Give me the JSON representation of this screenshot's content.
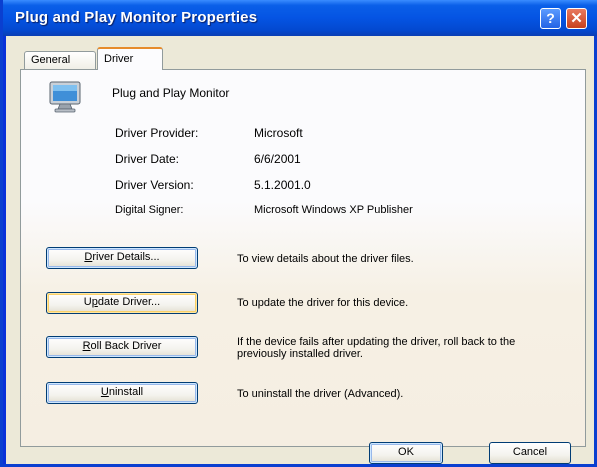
{
  "window": {
    "title": "Plug and Play Monitor Properties",
    "help_glyph": "?",
    "close_glyph": "✕"
  },
  "tabs": [
    {
      "label": "General",
      "selected": false
    },
    {
      "label": "Driver",
      "selected": true
    }
  ],
  "device": {
    "name": "Plug and Play Monitor",
    "icon": "monitor-icon"
  },
  "driver_info": [
    {
      "label": "Driver Provider:",
      "value": "Microsoft"
    },
    {
      "label": "Driver Date:",
      "value": "6/6/2001"
    },
    {
      "label": "Driver Version:",
      "value": "5.1.2001.0"
    },
    {
      "label": "Digital Signer:",
      "value": "Microsoft Windows XP Publisher"
    }
  ],
  "actions": [
    {
      "label": "Driver Details...",
      "mnemonic": "D",
      "description": "To view details about the driver files."
    },
    {
      "label": "Update Driver...",
      "mnemonic": "p",
      "description": "To update the driver for this device."
    },
    {
      "label": "Roll Back Driver",
      "mnemonic": "R",
      "description": "If the device fails after updating the driver, roll back to the previously installed driver."
    },
    {
      "label": "Uninstall",
      "mnemonic": "U",
      "description": "To uninstall the driver (Advanced)."
    }
  ],
  "footer": {
    "ok_label": "OK",
    "cancel_label": "Cancel"
  },
  "colors": {
    "title_bar": "#0554e3",
    "dialog_bg": "#ece9d8",
    "tab_accent": "#e68b2c"
  }
}
